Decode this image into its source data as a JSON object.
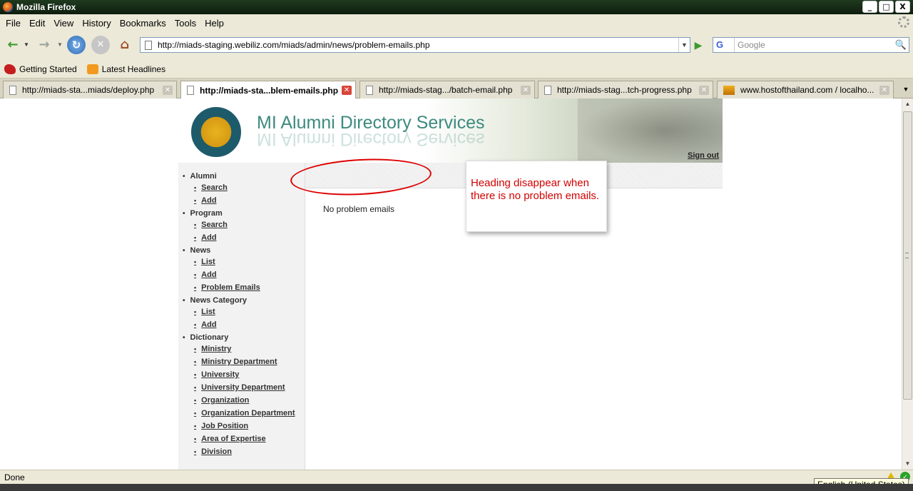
{
  "window": {
    "title": "Mozilla Firefox",
    "buttons": [
      "_",
      "□",
      "X"
    ]
  },
  "menu": [
    "File",
    "Edit",
    "View",
    "History",
    "Bookmarks",
    "Tools",
    "Help"
  ],
  "nav": {
    "back": "←",
    "forward": "→",
    "reload": "↻",
    "stop": "✕",
    "home": "⌂",
    "go": "▶",
    "url": "http://miads-staging.webiliz.com/miads/admin/news/problem-emails.php",
    "url_dropdown": "▼",
    "search_engine": "G",
    "search_placeholder": "Google",
    "search_button": "🔍"
  },
  "bookmarks": [
    {
      "label": "Getting Started",
      "icon": "getting-started-icon"
    },
    {
      "label": "Latest Headlines",
      "icon": "rss-feed-icon"
    }
  ],
  "tabs": [
    {
      "label": "http://miads-sta...miads/deploy.php",
      "active": false
    },
    {
      "label": "http://miads-sta...blem-emails.php",
      "active": true
    },
    {
      "label": "http://miads-stag.../batch-email.php",
      "active": false
    },
    {
      "label": "http://miads-stag...tch-progress.php",
      "active": false
    },
    {
      "label": "www.hostofthailand.com / localho...",
      "active": false
    }
  ],
  "site": {
    "title": "MI Alumni Directory Services",
    "signout": "Sign out"
  },
  "sidebar": [
    {
      "heading": "Alumni",
      "items": [
        "Search",
        "Add"
      ]
    },
    {
      "heading": "Program",
      "items": [
        "Search",
        "Add"
      ]
    },
    {
      "heading": "News",
      "items": [
        "List",
        "Add",
        "Problem Emails"
      ]
    },
    {
      "heading": "News Category",
      "items": [
        "List",
        "Add"
      ]
    },
    {
      "heading": "Dictionary",
      "items": [
        "Ministry",
        "Ministry Department",
        "University",
        "University Department",
        "Organization",
        "Organization Department",
        "Job Position",
        "Area of Expertise",
        "Division"
      ]
    }
  ],
  "main": {
    "message": "No problem emails"
  },
  "annotation": {
    "callout": "Heading disappear when there is no problem emails."
  },
  "status": {
    "text": "Done",
    "language": "English (United States)"
  },
  "colors": {
    "title_green": "#3c8a7f",
    "annotation_red": "#d10000"
  }
}
